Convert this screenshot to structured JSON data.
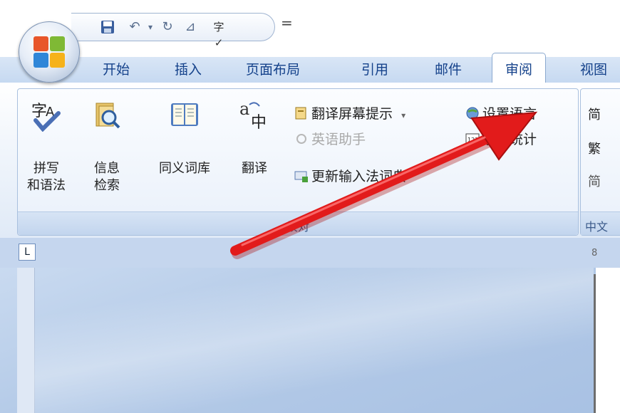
{
  "quick_access": {
    "more": "="
  },
  "tabs": [
    "开始",
    "插入",
    "页面布局",
    "引用",
    "邮件",
    "审阅",
    "视图"
  ],
  "ribbon": {
    "proofing": {
      "group_label": "校对",
      "big_buttons": [
        {
          "label": "拼写\n和语法"
        },
        {
          "label": "信息\n检索"
        },
        {
          "label": "同义词库"
        },
        {
          "label": "翻译"
        }
      ],
      "small_buttons": {
        "translate_tip": "翻译屏幕提示",
        "translate_tip_arrow": "▾",
        "english_assistant": "英语助手",
        "update_ime": "更新输入法词典",
        "set_language": "设置语言",
        "word_count": "字数统计"
      }
    },
    "chinese": {
      "group_label": "中文",
      "items": [
        "简",
        "繁",
        "简"
      ]
    }
  },
  "ruler": {
    "corner": "L",
    "numbers": "8"
  },
  "colors": {
    "arrow": "#e21b1b",
    "tab_text": "#15428b",
    "ribbon_border": "#a9c0de"
  }
}
